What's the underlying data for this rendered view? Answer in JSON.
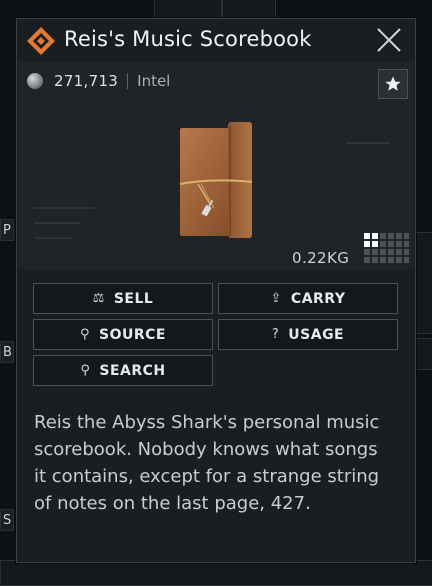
{
  "item": {
    "title": "Reis's Music Scorebook",
    "price": "271,713",
    "category": "Intel",
    "weight": "0.22KG",
    "description": "Reis the Abyss Shark's personal music scorebook. Nobody knows what songs it contains, except for a strange string of notes on the last page, 427."
  },
  "actions": {
    "sell": "SELL",
    "carry": "CARRY",
    "source": "SOURCE",
    "usage": "USAGE",
    "search": "SEARCH"
  },
  "background": {
    "letters": [
      "P",
      "B",
      "S"
    ]
  },
  "icons": {
    "logo": "diamond-logo-icon",
    "close": "close-icon",
    "coin": "coin-icon",
    "favorite": "star-icon",
    "sell": "sell-icon",
    "carry": "upload-icon",
    "source": "magnifier-icon",
    "usage": "question-icon",
    "search": "magnifier-icon"
  },
  "colors": {
    "accent": "#e07a2e",
    "panel": "#1a1e21",
    "text": "#e6e6e6"
  }
}
